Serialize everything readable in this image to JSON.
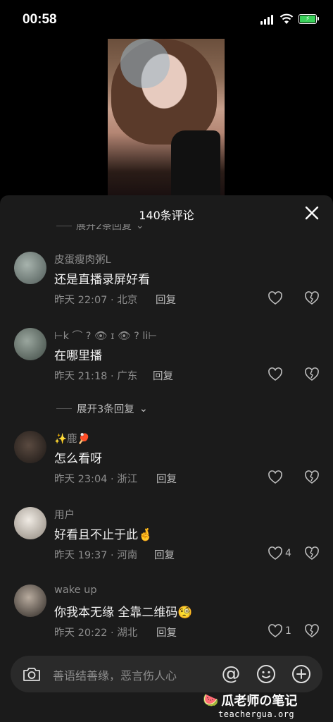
{
  "status_bar": {
    "time": "00:58",
    "battery_color": "#3ad05a"
  },
  "sheet": {
    "title": "140条评论",
    "cut_expand_label": "展开2条回复"
  },
  "comments": [
    {
      "username": "皮蛋瘦肉粥L",
      "text": "还是直播录屏好看",
      "meta": "昨天 22:07 · 北京",
      "reply": "回复",
      "likes": "",
      "avatar_color": "#7b8a86"
    },
    {
      "username": "⊢k ⌒ ? 👁 ɪ 👁 ? li⊢",
      "text": "在哪里播",
      "meta": "昨天 21:18 · 广东",
      "reply": "回复",
      "likes": "",
      "avatar_color": "#6c7870"
    },
    {
      "username": "✨鹿🏓",
      "text": "怎么看呀",
      "meta": "昨天 23:04 · 浙江",
      "reply": "回复",
      "likes": "",
      "avatar_color": "#2e2723"
    },
    {
      "username": "用户",
      "text": "好看且不止于此🤞",
      "meta": "昨天 19:37 · 河南",
      "reply": "回复",
      "likes": "4",
      "avatar_color": "#d8d3cc"
    },
    {
      "username": "wake up",
      "text": "你我本无缘 全靠二维码🧐",
      "meta": "昨天 20:22 · 湖北",
      "reply": "回复",
      "likes": "1",
      "avatar_color": "#5c5650"
    }
  ],
  "expand_replies": {
    "label": "展开3条回复"
  },
  "input": {
    "placeholder": "善语结善缘，恶言伤人心",
    "at_symbol": "@"
  },
  "watermark": {
    "title": "瓜老师の笔记",
    "url": "teachergua.org"
  }
}
